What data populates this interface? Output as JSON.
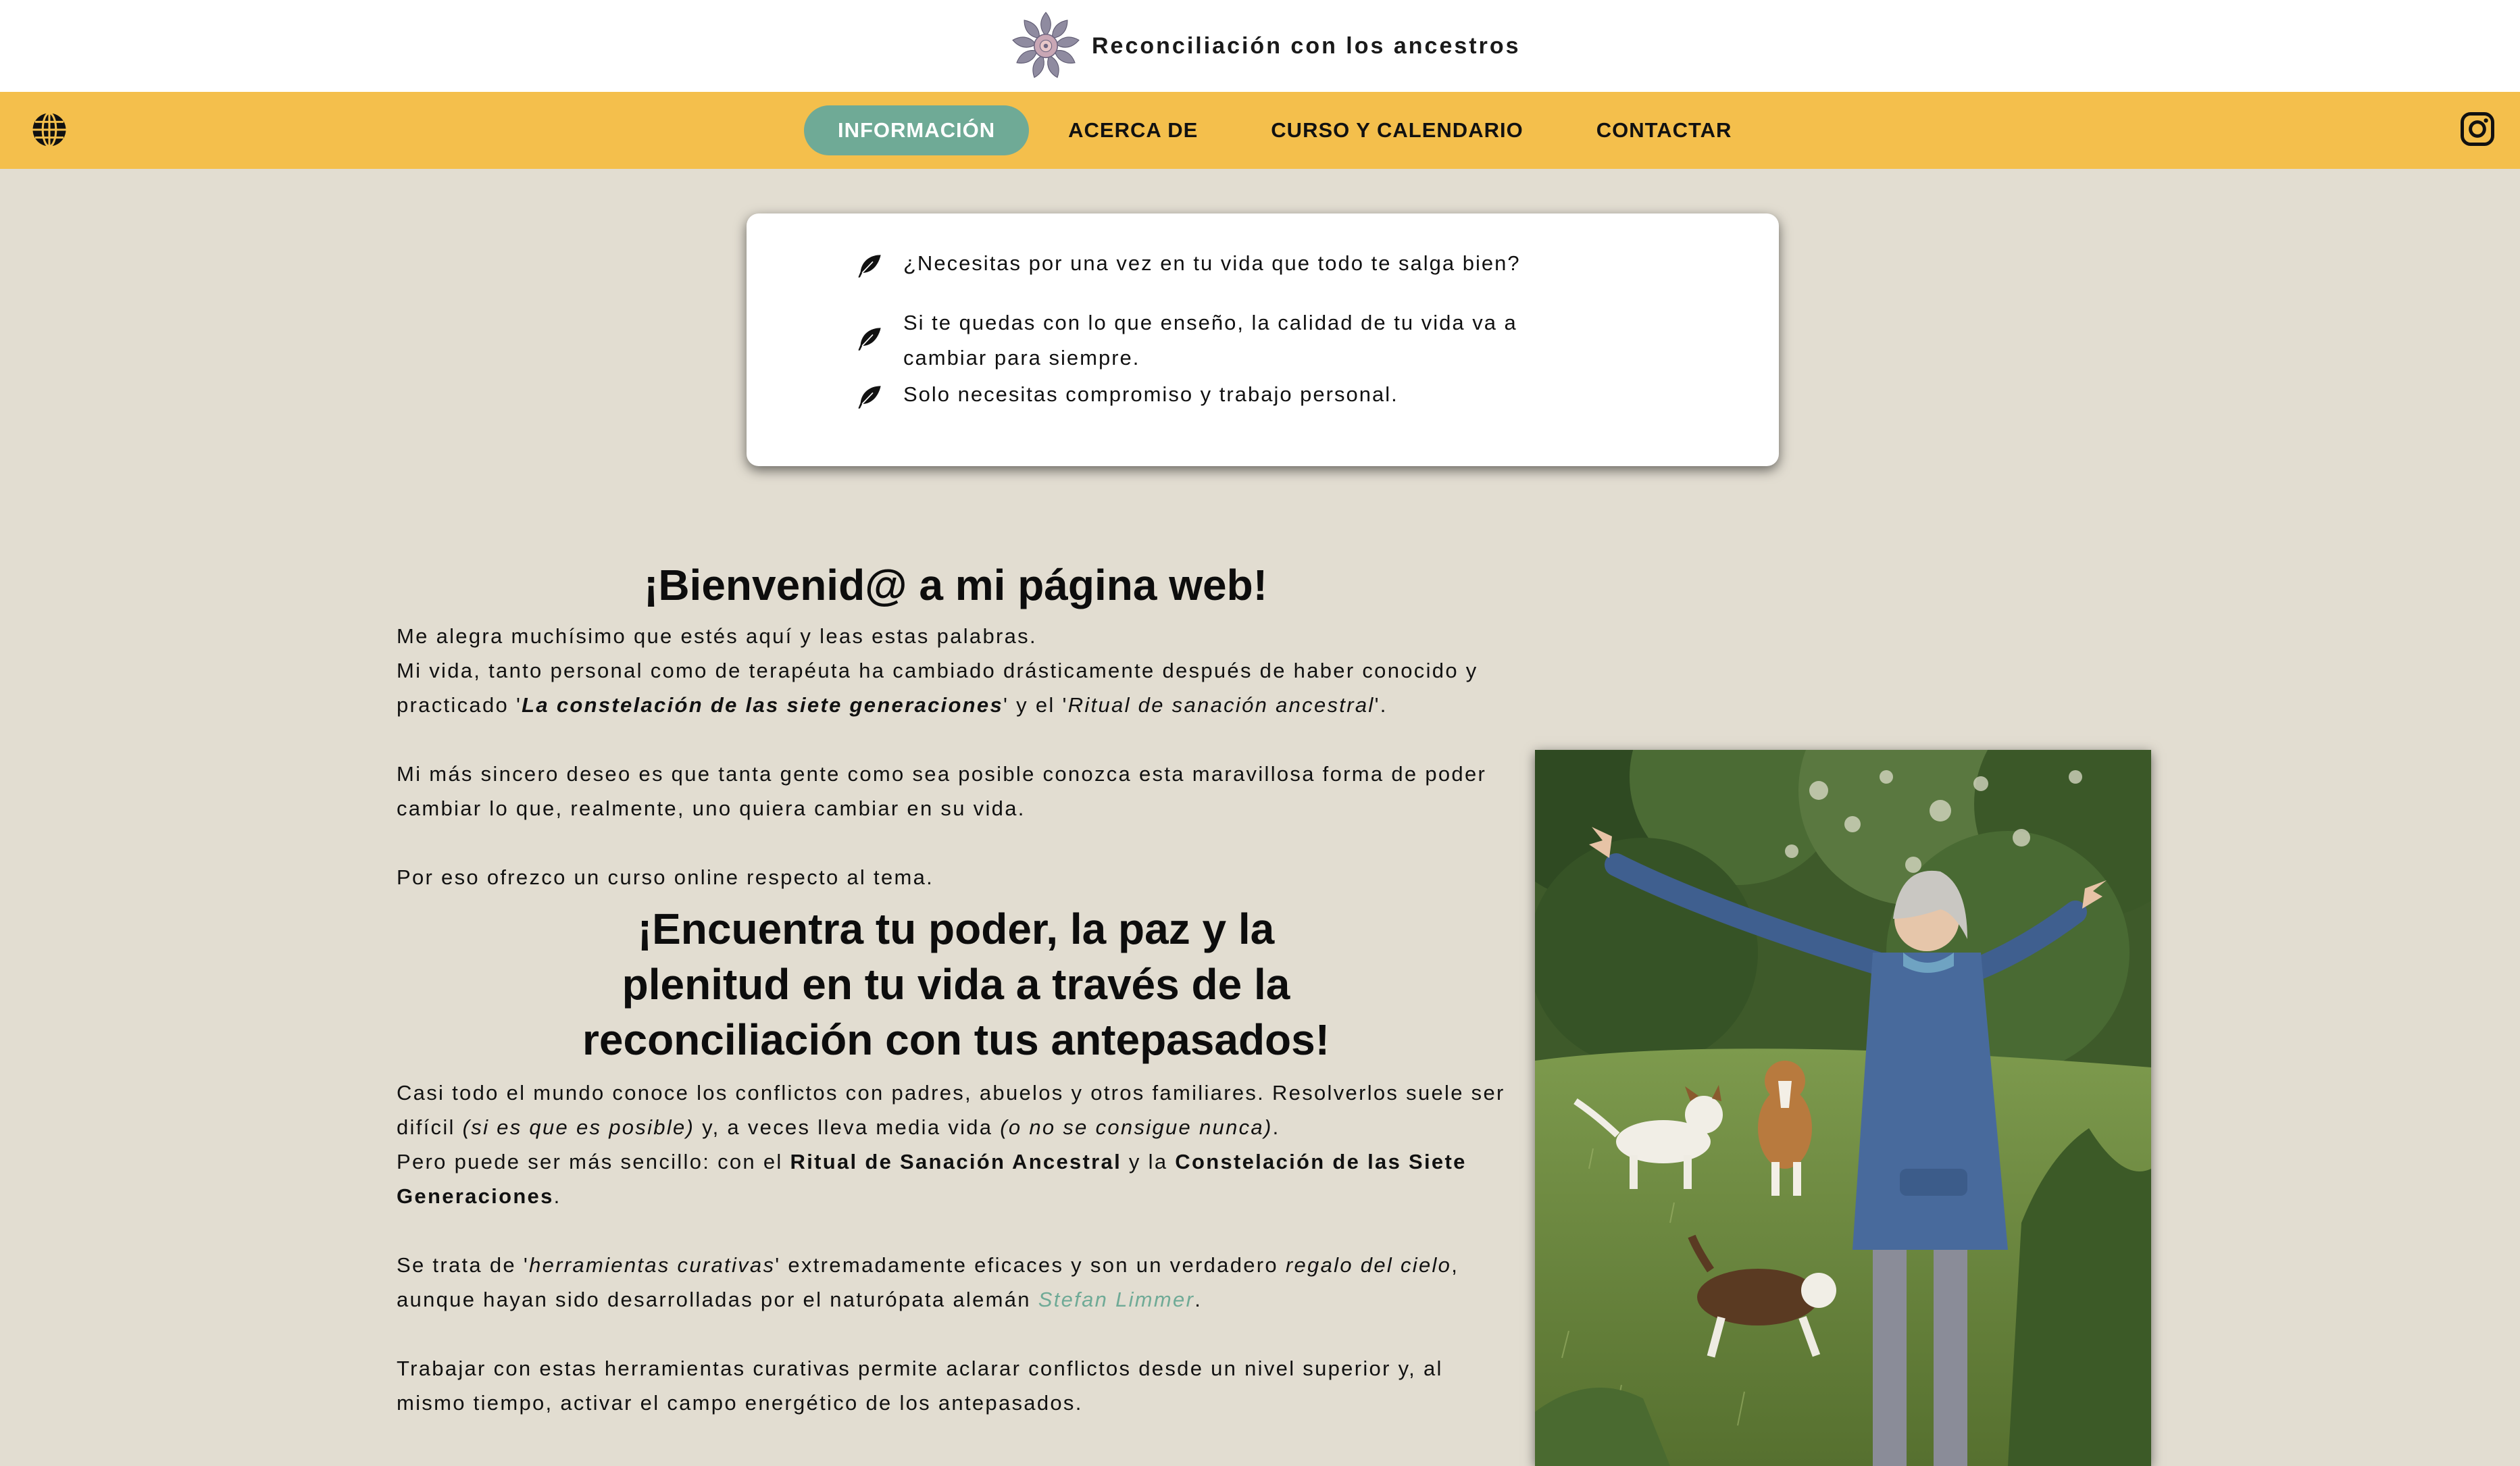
{
  "site": {
    "name": "Reconciliación con los ancestros"
  },
  "nav": {
    "items": [
      {
        "label": "INFORMACIÓN",
        "active": true
      },
      {
        "label": "ACERCA DE"
      },
      {
        "label": "CURSO Y CALENDARIO"
      },
      {
        "label": "CONTACTAR"
      }
    ],
    "language_icon": "globe-icon",
    "social_icon": "instagram-icon"
  },
  "benefits": [
    "¿Necesitas por una vez en tu vida que todo te salga bien?",
    "Si te quedas con lo que enseño, la calidad de tu vida va a cambiar para siempre.",
    "Solo necesitas compromiso y trabajo personal."
  ],
  "welcome": {
    "title": "¡Bienvenid@ a mi página web!",
    "p1_line1": "Me alegra muchísimo que estés aquí y leas estas palabras.",
    "p1_line2_a": "Mi vida, tanto personal como de terapéuta ha cambiado drásticamente después de haber conocido y practicado '",
    "p1_line2_b": "La constelación de las siete generaciones",
    "p1_line2_c": "' y el '",
    "p1_line2_d": "Ritual de sanación ancestral",
    "p1_line2_e": "'.",
    "p2": "Mi más sincero deseo es que tanta gente como sea posible conozca esta maravillosa forma de poder cambiar lo que, realmente, uno quiera cambiar en su vida.",
    "p3": "Por eso ofrezco un curso online respecto al tema."
  },
  "section": {
    "title": "¡Encuentra tu poder, la paz y la plenitud en tu vida a través de la reconciliación con tus antepasados!",
    "p1_a": "Casi todo el mundo conoce los conflictos con padres, abuelos y otros familiares. Resolverlos suele ser difícil ",
    "p1_b": "(si es que es posible)",
    "p1_c": " y, a veces lleva media vida ",
    "p1_d": "(o no se consigue nunca)",
    "p1_e": ".",
    "p2_a": "Pero puede ser más sencillo: con el ",
    "p2_b": "Ritual de Sanación Ancestral",
    "p2_c": " y la ",
    "p2_d": "Constelación de las Siete Generaciones",
    "p2_e": ".",
    "p3_a": "Se trata de '",
    "p3_b": "herramientas curativas",
    "p3_c": "' extremadamente eficaces y son un verdadero ",
    "p3_d": "regalo del cielo",
    "p3_e": ", aunque hayan sido desarrolladas por el naturópata alemán ",
    "p3_link": "Stefan Limmer",
    "p3_f": ".",
    "p4": "Trabajar con estas herramientas curativas permite aclarar conflictos desde un nivel superior y, al mismo tiempo, activar el campo energético de los antepasados."
  },
  "colors": {
    "nav_bg": "#f4bf4c",
    "accent": "#6faa96",
    "page_bg": "#e2ddd1"
  }
}
